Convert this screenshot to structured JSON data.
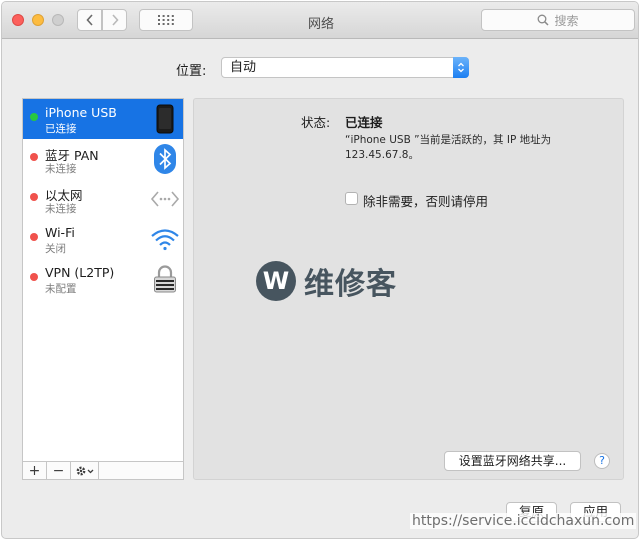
{
  "window": {
    "title": "网络",
    "search_placeholder": "搜索"
  },
  "location": {
    "label": "位置:",
    "value": "自动"
  },
  "services": [
    {
      "name": "iPhone USB",
      "status": "已连接",
      "dot_color": "#28c840",
      "icon": "iphone-icon",
      "selected": true
    },
    {
      "name": "蓝牙 PAN",
      "status": "未连接",
      "dot_color": "#f0524c",
      "icon": "bluetooth-icon",
      "selected": false
    },
    {
      "name": "以太网",
      "status": "未连接",
      "dot_color": "#f0524c",
      "icon": "ethernet-icon",
      "selected": false
    },
    {
      "name": "Wi-Fi",
      "status": "关闭",
      "dot_color": "#f0524c",
      "icon": "wifi-icon",
      "selected": false
    },
    {
      "name": "VPN (L2TP)",
      "status": "未配置",
      "dot_color": "#f0524c",
      "icon": "vpn-lock-icon",
      "selected": false
    }
  ],
  "sidebar_tools": {
    "add": "+",
    "remove": "−"
  },
  "detail": {
    "status_label": "状态:",
    "status_value": "已连接",
    "description": "“iPhone USB ”当前是活跃的，其 IP 地址为 123.45.67.8。",
    "checkbox_label": "除非需要，否则请停用",
    "checkbox_checked": false,
    "bluetooth_share_button": "设置蓝牙网络共享...",
    "help_label": "?"
  },
  "watermark": {
    "letter": "W",
    "text": "维修客",
    "url": "https://service.iccidchaxun.com"
  },
  "footer": {
    "revert": "复原",
    "apply": "应用"
  },
  "colors": {
    "selection": "#1773e4",
    "connected": "#28c840",
    "disconnected": "#f0524c"
  }
}
